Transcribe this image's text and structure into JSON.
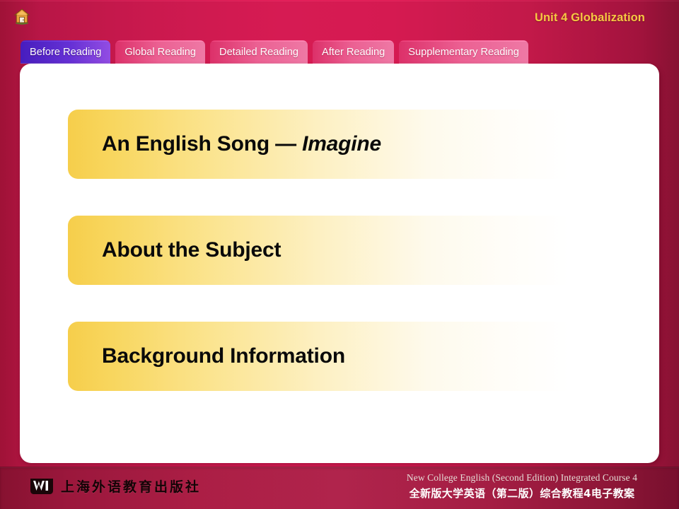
{
  "header": {
    "home_icon": "home-icon",
    "unit_title": "Unit 4 Globalization"
  },
  "tabs": [
    {
      "label": "Before Reading",
      "active": true
    },
    {
      "label": "Global Reading",
      "active": false
    },
    {
      "label": "Detailed Reading",
      "active": false
    },
    {
      "label": "After Reading",
      "active": false
    },
    {
      "label": "Supplementary Reading",
      "active": false
    }
  ],
  "menu": {
    "items": [
      {
        "text_before": "An English Song — ",
        "text_italic": "Imagine",
        "text_after": ""
      },
      {
        "text_before": "About the Subject",
        "text_italic": "",
        "text_after": ""
      },
      {
        "text_before": "Background Information",
        "text_italic": "",
        "text_after": ""
      }
    ]
  },
  "footer": {
    "publisher_name": "上海外语教育出版社",
    "publisher_mark": "W",
    "course_english": "New College English (Second Edition) Integrated Course 4",
    "course_chinese": "全新版大学英语（第二版）综合教程4电子教案"
  },
  "colors": {
    "background_red": "#d51a52",
    "footer_red": "#b52049",
    "tab_inactive": "#f8659a",
    "tab_active": "#6b33e0",
    "unit_title_gold": "#f6c843",
    "button_gold": "#f6ce4b",
    "panel_white": "#ffffff"
  }
}
